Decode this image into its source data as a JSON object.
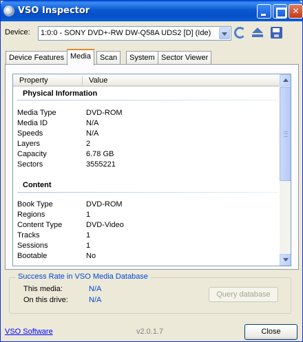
{
  "window": {
    "title": "VSO Inspector"
  },
  "device": {
    "label": "Device:",
    "selected": "1:0:0 - SONY DVD+-RW DW-Q58A UDS2 [D] (Ide)"
  },
  "tabs": [
    "Device Features",
    "Media",
    "Scan",
    "System",
    "Sector Viewer"
  ],
  "active_tab": "Media",
  "table": {
    "columns": [
      "Property",
      "Value"
    ],
    "sections": [
      {
        "title": "Physical Information",
        "rows": [
          {
            "property": "Media Type",
            "value": "DVD-ROM"
          },
          {
            "property": "Media ID",
            "value": "N/A"
          },
          {
            "property": "Speeds",
            "value": "N/A"
          },
          {
            "property": "Layers",
            "value": "2"
          },
          {
            "property": "Capacity",
            "value": "6.78 GB"
          },
          {
            "property": "Sectors",
            "value": "3555221"
          }
        ]
      },
      {
        "title": "Content",
        "rows": [
          {
            "property": "Book Type",
            "value": "DVD-ROM"
          },
          {
            "property": "Regions",
            "value": "1"
          },
          {
            "property": "Content Type",
            "value": "DVD-Video"
          },
          {
            "property": "Tracks",
            "value": "1"
          },
          {
            "property": "Sessions",
            "value": "1"
          },
          {
            "property": "Bootable",
            "value": "No"
          }
        ]
      }
    ]
  },
  "success_rate": {
    "title": "Success Rate in VSO Media Database",
    "this_media_label": "This media:",
    "this_media_value": "N/A",
    "this_drive_label": "On this drive:",
    "this_drive_value": "N/A",
    "query_button": "Query database"
  },
  "footer": {
    "link": "VSO Software",
    "version": "v2.0.1.7",
    "close_button": "Close"
  },
  "colors": {
    "titlebar": "#0a58d0",
    "accent_link": "#0046d5",
    "tab_highlight": "#e68b2c"
  }
}
